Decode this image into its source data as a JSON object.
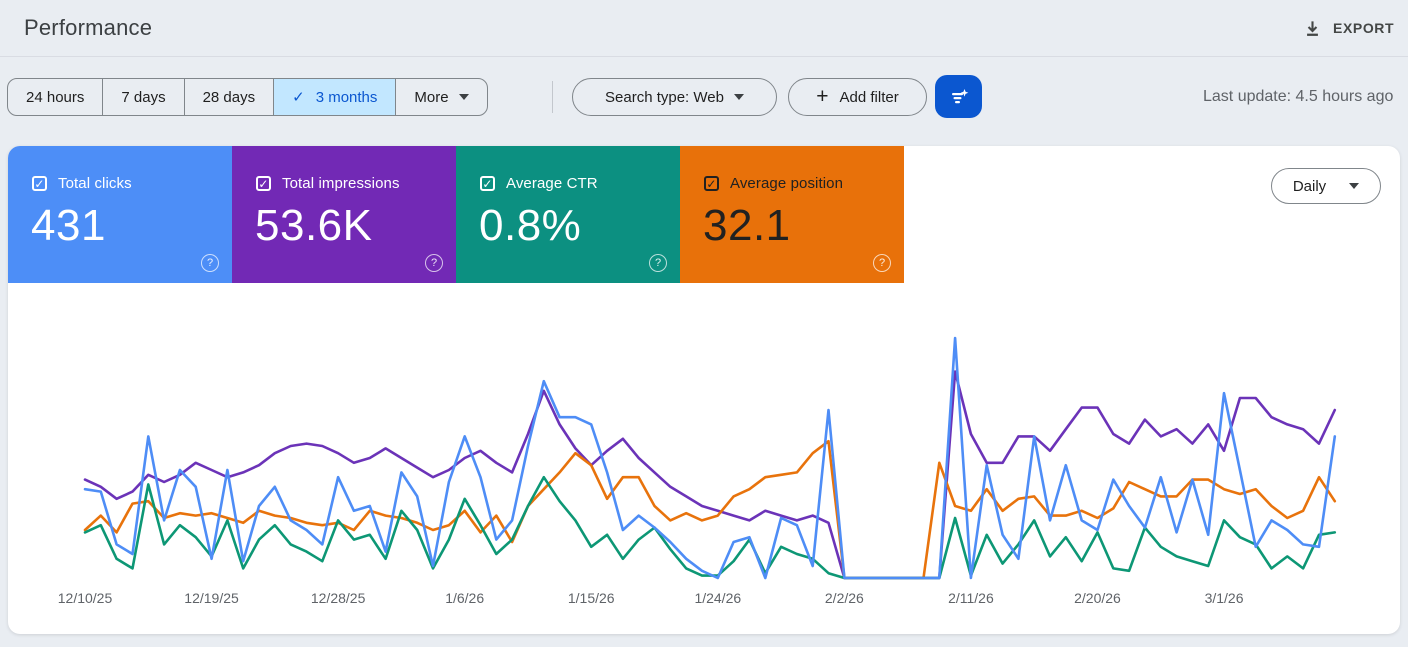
{
  "header": {
    "title": "Performance",
    "export_label": "EXPORT"
  },
  "toolbar": {
    "ranges": [
      {
        "label": "24 hours",
        "selected": false
      },
      {
        "label": "7 days",
        "selected": false
      },
      {
        "label": "28 days",
        "selected": false
      },
      {
        "label": "3 months",
        "selected": true
      }
    ],
    "more_label": "More",
    "search_type_label": "Search type: Web",
    "add_filter_label": "Add filter",
    "last_update": "Last update: 4.5 hours ago"
  },
  "granularity": {
    "selected": "Daily"
  },
  "metrics": [
    {
      "id": "clicks",
      "label": "Total clicks",
      "value": "431",
      "bg": "#4d8ef7",
      "fg": "#ffffff"
    },
    {
      "id": "impressions",
      "label": "Total impressions",
      "value": "53.6K",
      "bg": "#7229b5",
      "fg": "#ffffff"
    },
    {
      "id": "ctr",
      "label": "Average CTR",
      "value": "0.8%",
      "bg": "#0c9081",
      "fg": "#ffffff"
    },
    {
      "id": "position",
      "label": "Average position",
      "value": "32.1",
      "bg": "#e8710a",
      "fg": "#212121"
    }
  ],
  "chart_data": {
    "type": "line",
    "title": "",
    "xlabel": "date (daily, 12/10/25 - 3/8/26)",
    "ylabel": "",
    "grid": false,
    "legend_position": "none",
    "note": "No visible y axis; each series plotted on its own hidden scale. Values below are relative heights 0-100 of the plot area. Flat zero segment 2/3/26-2/9/26 (no data). Summary totals shown in tiles: clicks 431, impressions 53.6K, CTR 0.8%, position 32.1.",
    "x_tick_labels": [
      "12/10/25",
      "12/19/25",
      "12/28/25",
      "1/6/26",
      "1/15/26",
      "1/24/26",
      "2/2/26",
      "2/11/26",
      "2/20/26",
      "3/1/26"
    ],
    "series": [
      {
        "name": "Total clicks",
        "color": "#4e8df6",
        "values": [
          37,
          36,
          14,
          10,
          59,
          24,
          45,
          38,
          8,
          45,
          7,
          30,
          38,
          24,
          20,
          14,
          42,
          28,
          30,
          11,
          44,
          34,
          5,
          40,
          59,
          42,
          16,
          24,
          55,
          82,
          67,
          67,
          64,
          44,
          20,
          26,
          21,
          15,
          8,
          3,
          0,
          15,
          17,
          0,
          25,
          22,
          5,
          70,
          0,
          0,
          0,
          0,
          0,
          0,
          0,
          100,
          0,
          47,
          18,
          8,
          59,
          24,
          47,
          24,
          20,
          41,
          30,
          21,
          42,
          19,
          41,
          18,
          77,
          45,
          13,
          24,
          20,
          14,
          13,
          59
        ]
      },
      {
        "name": "Total impressions",
        "color": "#6b33b8",
        "values": [
          41,
          38,
          33,
          36,
          43,
          40,
          43,
          48,
          45,
          42,
          44,
          47,
          52,
          55,
          56,
          55,
          52,
          48,
          50,
          54,
          50,
          46,
          42,
          45,
          50,
          53,
          48,
          44,
          60,
          78,
          64,
          54,
          47,
          53,
          58,
          50,
          44,
          38,
          34,
          30,
          28,
          26,
          24,
          28,
          26,
          24,
          26,
          23,
          0,
          0,
          0,
          0,
          0,
          0,
          0,
          86,
          60,
          48,
          48,
          59,
          59,
          53,
          62,
          71,
          71,
          60,
          56,
          66,
          59,
          62,
          56,
          64,
          53,
          75,
          75,
          67,
          64,
          62,
          56,
          70
        ]
      },
      {
        "name": "Average CTR",
        "color": "#0d9775",
        "values": [
          19,
          22,
          8,
          4,
          39,
          14,
          22,
          17,
          9,
          24,
          4,
          16,
          22,
          14,
          11,
          7,
          24,
          16,
          18,
          8,
          28,
          20,
          4,
          16,
          33,
          22,
          10,
          16,
          30,
          42,
          32,
          24,
          13,
          18,
          8,
          16,
          21,
          12,
          4,
          1,
          1,
          7,
          16,
          2,
          13,
          10,
          8,
          2,
          0,
          0,
          0,
          0,
          0,
          0,
          0,
          25,
          1,
          18,
          6,
          14,
          24,
          9,
          17,
          7,
          19,
          4,
          3,
          21,
          13,
          9,
          7,
          5,
          24,
          17,
          14,
          4,
          9,
          4,
          18,
          19
        ]
      },
      {
        "name": "Average position",
        "color": "#e8730c",
        "values": [
          20,
          26,
          19,
          31,
          32,
          25,
          27,
          26,
          27,
          25,
          23,
          28,
          26,
          25,
          23,
          22,
          23,
          20,
          28,
          26,
          25,
          23,
          20,
          22,
          28,
          19,
          26,
          15,
          30,
          37,
          44,
          52,
          47,
          33,
          42,
          42,
          30,
          24,
          27,
          24,
          26,
          34,
          37,
          42,
          43,
          44,
          52,
          57,
          0,
          0,
          0,
          0,
          0,
          0,
          48,
          30,
          28,
          37,
          28,
          33,
          34,
          26,
          26,
          28,
          25,
          29,
          40,
          37,
          34,
          34,
          41,
          41,
          37,
          35,
          37,
          30,
          25,
          28,
          42,
          32
        ]
      }
    ]
  }
}
